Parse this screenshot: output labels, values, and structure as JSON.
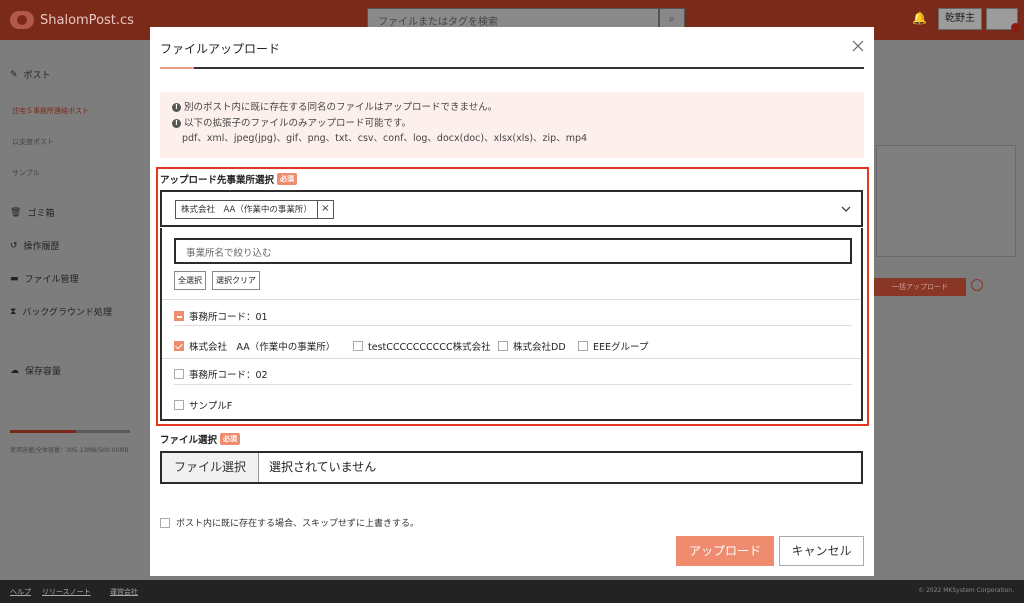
{
  "app": {
    "logo_text": "ShalomPost.cs",
    "search_placeholder": "ファイルまたはタグを検索",
    "search_icon": "search-icon",
    "user_name": "乾野主"
  },
  "sidebar": {
    "items": [
      {
        "label": "ポスト",
        "icon": "post-icon"
      },
      {
        "label": "ゴミ箱",
        "icon": "trash-icon"
      },
      {
        "label": "操作履歴",
        "icon": "history-icon"
      },
      {
        "label": "ファイル管理",
        "icon": "file-manage-icon"
      },
      {
        "label": "バックグラウンド処理",
        "icon": "background-icon"
      },
      {
        "label": "保存容量",
        "icon": "cloud-icon"
      }
    ],
    "sub_items": [
      "住宅５事務所連絡ポスト",
      "以支度ポスト",
      "サンプル"
    ],
    "storage_text": "使用容量/全体容量：305.13MB/500.00MB"
  },
  "background": {
    "bulk_upload_button": "一括アップロード"
  },
  "footer": {
    "links": [
      "ヘルプ",
      "リリースノート",
      "運営会社"
    ],
    "copyright": "© 2022 MKSystem Corporation."
  },
  "modal": {
    "title": "ファイルアップロード",
    "notice_lines": [
      "別のポスト内に既に存在する同名のファイルはアップロードできません。",
      "以下の拡張子のファイルのみアップロード可能です。"
    ],
    "extensions": "pdf、xml、jpeg(jpg)、gif、png、txt、csv、conf、log、docx(doc)、xlsx(xls)、zip、mp4",
    "office_select": {
      "label": "アップロード先事業所選択",
      "required_badge": "必須",
      "selected_tag": "株式会社　AA（作業中の事業所）",
      "tag_remove": "×",
      "filter_placeholder": "事業所名で絞り込む",
      "select_all": "全選択",
      "clear_selection": "選択クリア",
      "groups": [
        {
          "label": "事務所コード：01",
          "state": "partial",
          "options": [
            {
              "label": "株式会社　AA（作業中の事業所）",
              "checked": true
            },
            {
              "label": "testCCCCCCCCCC株式会社",
              "checked": false
            },
            {
              "label": "株式会社DD",
              "checked": false
            },
            {
              "label": "EEEグループ",
              "checked": false
            }
          ]
        },
        {
          "label": "事務所コード：02",
          "state": "unchecked",
          "options": []
        }
      ],
      "extra_option": "サンプルF"
    },
    "file_select": {
      "label": "ファイル選択",
      "required_badge": "必須",
      "button": "ファイル選択",
      "status": "選択されていません"
    },
    "overwrite_label": "ポスト内に既に存在する場合、スキップせずに上書きする。",
    "upload_button": "アップロード",
    "cancel_button": "キャンセル"
  },
  "colors": {
    "accent": "#ef8b6f",
    "highlight_border": "#e2381f",
    "notice_bg": "#fdf0ec"
  }
}
